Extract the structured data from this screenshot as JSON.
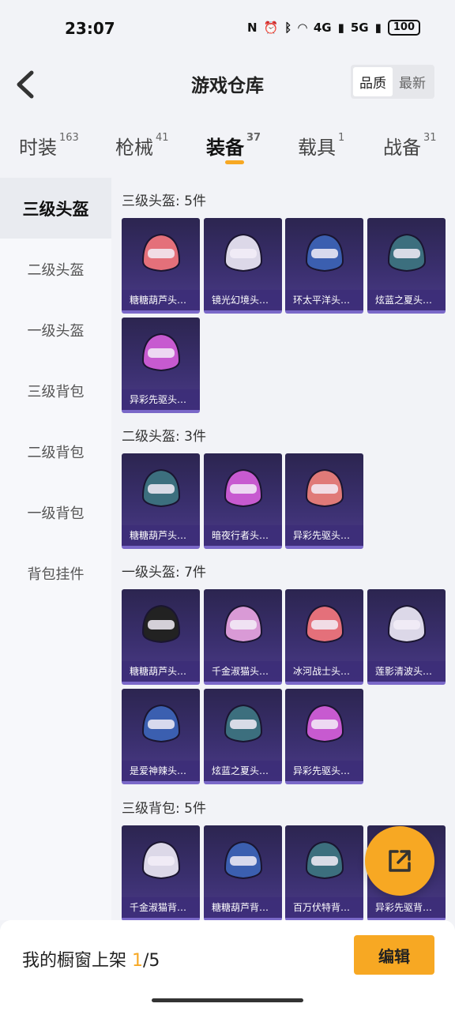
{
  "status": {
    "time": "23:07",
    "network1": "4G",
    "network2": "5G",
    "battery": "100"
  },
  "header": {
    "title": "游戏仓库",
    "sort_options": [
      "品质",
      "最新"
    ]
  },
  "tabs": [
    {
      "label": "时装",
      "count": "163"
    },
    {
      "label": "枪械",
      "count": "41"
    },
    {
      "label": "装备",
      "count": "37"
    },
    {
      "label": "载具",
      "count": "1"
    },
    {
      "label": "战备",
      "count": "31"
    }
  ],
  "sidebar": [
    "三级头盔",
    "二级头盔",
    "一级头盔",
    "三级背包",
    "二级背包",
    "一级背包",
    "背包挂件"
  ],
  "sections": [
    {
      "title": "三级头盔: 5件",
      "items": [
        "糖糖葫芦头…",
        "镜光幻境头…",
        "环太平洋头…",
        "炫蓝之夏头…",
        "异彩先驱头…"
      ]
    },
    {
      "title": "二级头盔: 3件",
      "items": [
        "糖糖葫芦头…",
        "暗夜行者头…",
        "异彩先驱头…"
      ]
    },
    {
      "title": "一级头盔: 7件",
      "items": [
        "糖糖葫芦头…",
        "千金淑猫头…",
        "冰河战士头…",
        "莲影清波头…",
        "是爱神辣头…",
        "炫蓝之夏头…",
        "异彩先驱头…"
      ]
    },
    {
      "title": "三级背包: 5件",
      "items": [
        "千金淑猫背…",
        "糖糖葫芦背…",
        "百万伏特背…",
        "异彩先驱背…"
      ]
    }
  ],
  "bottom": {
    "prefix": "我的橱窗上架 ",
    "current": "1",
    "suffix": "/5",
    "edit_label": "编辑"
  },
  "colors": {
    "accent": "#f7a823",
    "card_bg": "#3a2f6e"
  }
}
